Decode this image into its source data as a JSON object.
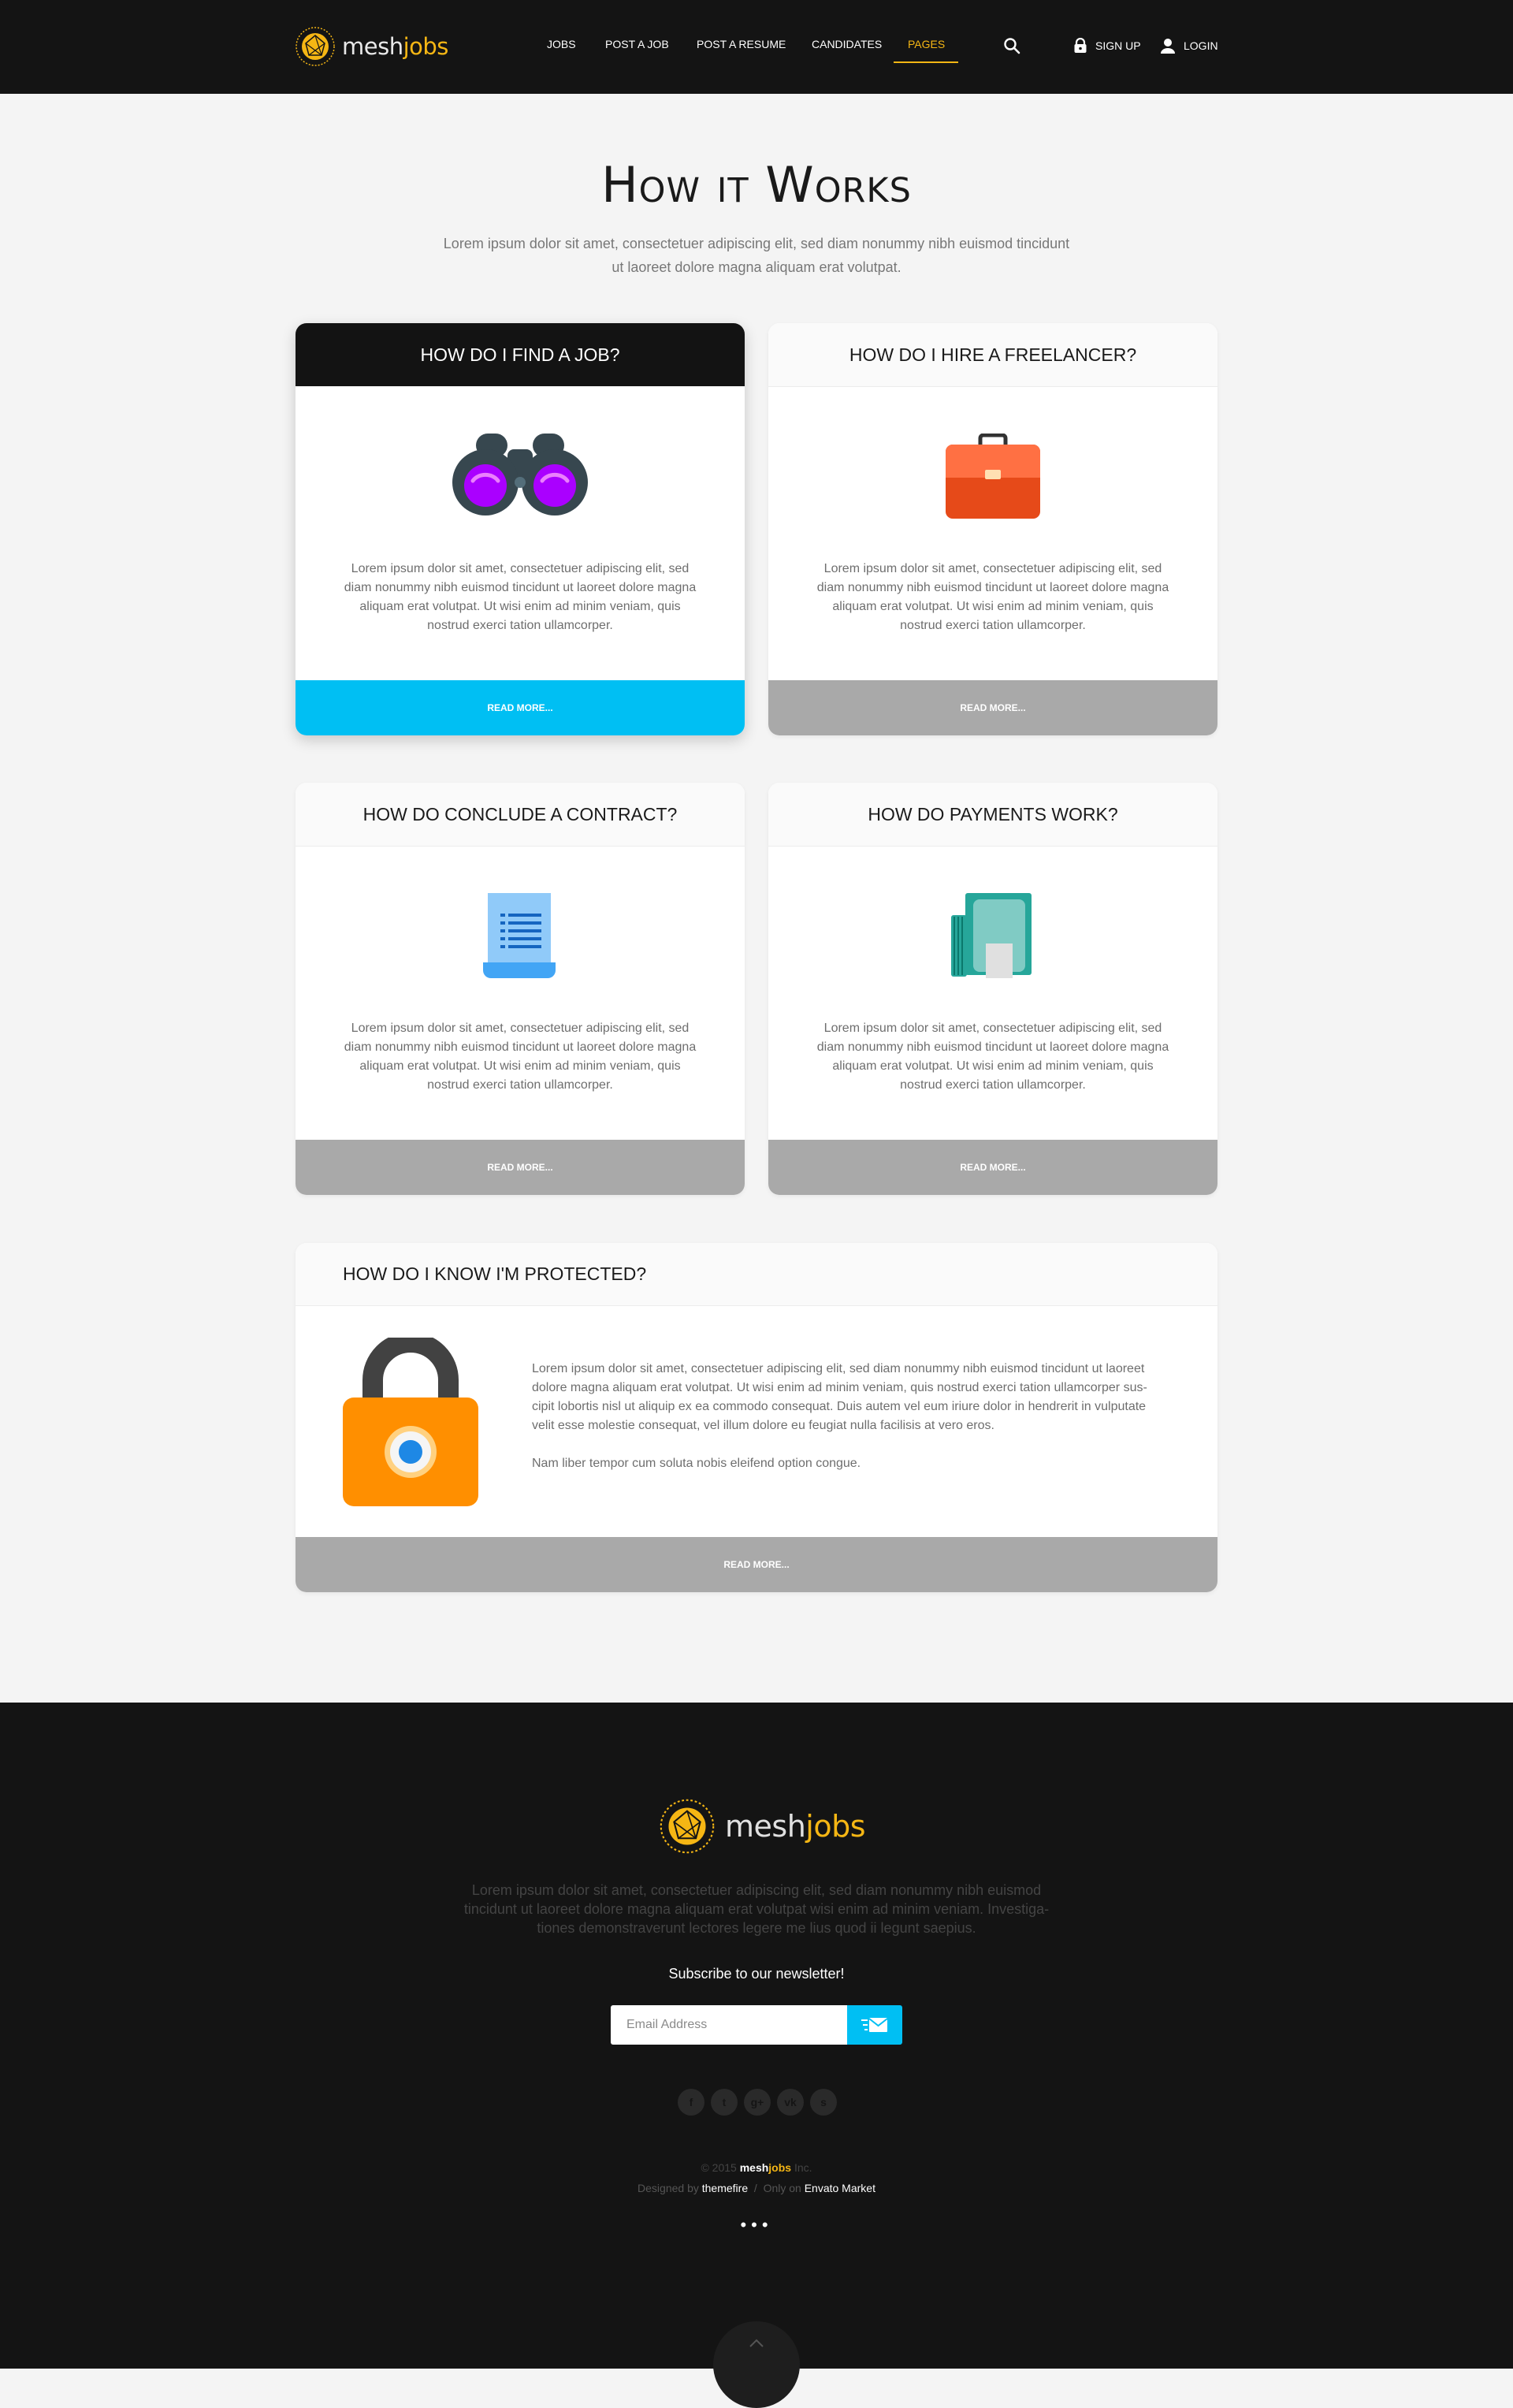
{
  "brand": {
    "name_plain": "mesh",
    "name_accent": "jobs"
  },
  "nav": {
    "items": [
      {
        "label": "JOBS"
      },
      {
        "label": "POST A JOB"
      },
      {
        "label": "POST A RESUME"
      },
      {
        "label": "CANDIDATES"
      },
      {
        "label": "PAGES",
        "active": true
      }
    ],
    "search_icon": "search-icon",
    "signup_label": "SIGN UP",
    "login_label": "LOGIN"
  },
  "intro": {
    "title": "How it Works",
    "subtitle": "Lorem ipsum dolor sit amet, consectetuer adipiscing elit, sed diam nonummy nibh euismod tincidunt ut laoreet dolore magna aliquam erat volutpat."
  },
  "cards": [
    {
      "title": "HOW DO I FIND A JOB?",
      "icon": "binoculars-icon",
      "text": "Lorem ipsum dolor sit amet, consectetuer adipiscing elit, sed diam nonummy nibh euismod tincidunt ut laoreet dolore magna aliquam erat volutpat. Ut wisi enim ad minim veniam, quis nostrud exerci tation ullamcorper.",
      "button": "READ MORE..."
    },
    {
      "title": "HOW DO I HIRE A FREELANCER?",
      "icon": "briefcase-icon",
      "text": "Lorem ipsum dolor sit amet, consectetuer adipiscing elit, sed diam nonummy nibh euismod tincidunt ut laoreet dolore magna aliquam erat volutpat. Ut wisi enim ad minim veniam, quis nostrud exerci tation ullamcorper.",
      "button": "READ MORE..."
    },
    {
      "title": "HOW DO CONCLUDE A CONTRACT?",
      "icon": "document-icon",
      "text": "Lorem ipsum dolor sit amet, consectetuer adipiscing elit, sed diam nonummy nibh euismod tincidunt ut laoreet dolore magna aliquam erat volutpat. Ut wisi enim ad minim veniam, quis nostrud exerci tation ullamcorper.",
      "button": "READ MORE..."
    },
    {
      "title": "HOW DO PAYMENTS WORK?",
      "icon": "money-icon",
      "text": "Lorem ipsum dolor sit amet, consectetuer adipiscing elit, sed diam nonummy nibh euismod tincidunt ut laoreet dolore magna aliquam erat volutpat. Ut wisi enim ad minim veniam, quis nostrud exerci tation ullamcorper.",
      "button": "READ MORE..."
    }
  ],
  "protected": {
    "title": "HOW DO I KNOW I'M PROTECTED?",
    "icon": "padlock-icon",
    "paragraph1": "Lorem ipsum dolor sit amet, consectetuer adipiscing elit, sed diam nonummy nibh euismod tincidunt ut laoreet dolore magna aliquam erat volutpat. Ut wisi enim ad minim veniam, quis nostrud exerci tation ullamcorper sus-cipit lobortis nisl ut aliquip ex ea commodo consequat. Duis autem vel eum iriure dolor in hendrerit in vulputate velit esse molestie consequat, vel illum dolore eu feugiat nulla facilisis at vero eros.",
    "paragraph2": "Nam liber tempor cum soluta nobis eleifend option congue.",
    "button": "READ MORE..."
  },
  "footer": {
    "description": "Lorem ipsum dolor sit amet, consectetuer adipiscing elit, sed diam nonummy nibh euismod tincidunt ut laoreet dolore magna aliquam erat volutpat wisi enim ad minim veniam. Investiga-tiones demonstraverunt lectores legere me lius quod ii legunt saepius.",
    "newsletter_heading": "Subscribe to our newsletter!",
    "email_placeholder": "Email Address",
    "socials": [
      {
        "icon": "facebook-icon",
        "glyph": "f"
      },
      {
        "icon": "twitter-icon",
        "glyph": "t"
      },
      {
        "icon": "google-plus-icon",
        "glyph": "g+"
      },
      {
        "icon": "vk-icon",
        "glyph": "vk"
      },
      {
        "icon": "skype-icon",
        "glyph": "s"
      }
    ],
    "copyright_prefix": "© 2015",
    "copyright_brand_plain": "mesh",
    "copyright_brand_accent": "jobs",
    "copyright_suffix": "Inc.",
    "designed_by_label": "Designed by",
    "designer": "themefire",
    "separator": "/",
    "only_on_label": "Only on",
    "marketplace": "Envato Market",
    "dots": "•••"
  },
  "colors": {
    "accent_yellow": "#f5b614",
    "accent_cyan": "#00bff3",
    "dark": "#141414",
    "button_grey": "#a9a9a9"
  }
}
